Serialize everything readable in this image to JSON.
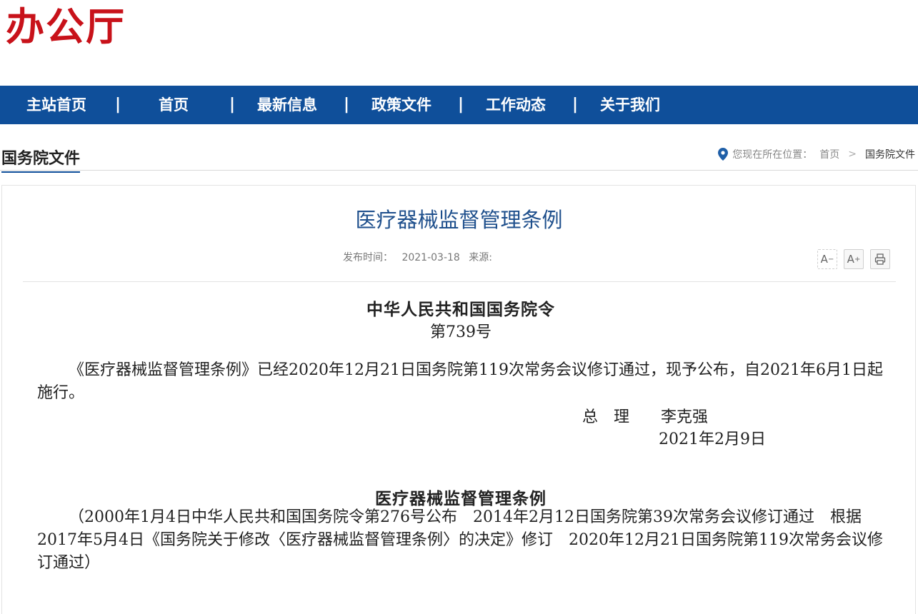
{
  "header": {
    "logo_text": "办公厅",
    "brand_color": "#c8121a"
  },
  "nav": {
    "background": "#0f4f9a",
    "items": [
      {
        "label": "主站首页"
      },
      {
        "label": "首页"
      },
      {
        "label": "最新信息"
      },
      {
        "label": "政策文件"
      },
      {
        "label": "工作动态"
      },
      {
        "label": "关于我们"
      }
    ],
    "separator": "|"
  },
  "section": {
    "title": "国务院文件",
    "breadcrumb": {
      "icon": "location-pin-icon",
      "prefix": "您现在所在位置：",
      "home": "首页",
      "arrow": ">",
      "current": "国务院文件"
    }
  },
  "article": {
    "title": "医疗器械监督管理条例",
    "meta": {
      "publish_label": "发布时间：",
      "publish_date": "2021-03-18",
      "source_label": "来源:"
    },
    "tools": [
      {
        "icon": "font-decrease-icon",
        "glyph": "A",
        "sup": "−"
      },
      {
        "icon": "font-increase-icon",
        "glyph": "A",
        "sup": "+"
      },
      {
        "icon": "print-icon",
        "glyph": "⎙"
      }
    ],
    "decree_heading": "中华人民共和国国务院令",
    "decree_number": "第739号",
    "decree_text": "《医疗器械监督管理条例》已经2020年12月21日国务院第119次常务会议修订通过，现予公布，自2021年6月1日起施行。",
    "signer": "总　理　　李克强",
    "sign_date": "2021年2月9日",
    "regulation_title": "医疗器械监督管理条例",
    "regulation_history": "（2000年1月4日中华人民共和国国务院令第276号公布　2014年2月12日国务院第39次常务会议修订通过　根据2017年5月4日《国务院关于修改〈医疗器械监督管理条例〉的决定》修订　2020年12月21日国务院第119次常务会议修订通过）"
  }
}
